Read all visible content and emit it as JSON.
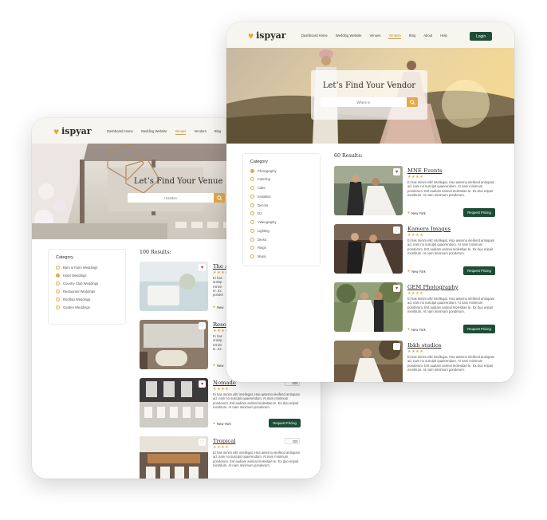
{
  "brand": {
    "name": "ispyar"
  },
  "venue_page": {
    "nav": [
      "Dashboard Home",
      "Wedding Website",
      "Venues",
      "Vendors",
      "Blog"
    ],
    "active_nav": "Venues",
    "hero_title": "Let’s Find Your Venue",
    "search_placeholder": "Houston",
    "filter": {
      "title": "Category",
      "options": [
        "Barn & Farm Weddings",
        "Hotel Weddings",
        "Country Club Weddings",
        "Restaurant Weddings",
        "Rooftop Weddings",
        "Garden Weddings"
      ],
      "selected": "Hotel Weddings"
    },
    "results_title": "100 Results:",
    "cards": [
      {
        "name": "The A",
        "location": "New",
        "liked": true
      },
      {
        "name": "Reso",
        "location": "New",
        "liked": false
      },
      {
        "name": "Nomade",
        "likes": "609",
        "description": "Ei has minim elitr intellegat. Hsa aeterno eleifend antiopam ad, nam no suscipit quaerendum. At nam minimum ponderum. Est audiam animal molestiae te. Ex duo eripuit mentitum. At nam minimum ponderum.",
        "location": "New York",
        "button": "Request Pricing",
        "liked": true
      },
      {
        "name": "Tropical",
        "likes": "309",
        "description": "Ei has minim elitr intellegat. Hsa aeterno eleifend antiopam ad, nam no suscipit quaerendum. At nam minimum ponderum. Est audiam animal molestiae te. Ex duo eripuit mentitum. At nam minimum ponderum.",
        "liked": false
      }
    ],
    "partial_desc": [
      "Ei has",
      "antiop",
      "minim",
      "te. Ex",
      "ponder"
    ]
  },
  "vendor_page": {
    "nav": [
      "Dashboard Home",
      "Wedding Website",
      "Venues",
      "Vendors",
      "Blog",
      "About",
      "Help"
    ],
    "active_nav": "Vendors",
    "login_label": "Login",
    "hero_title": "Let’s Find Your Vendor",
    "search_placeholder": "Where in",
    "filter": {
      "title": "Category",
      "options": [
        "Photography",
        "Catering",
        "Cake",
        "Invitation",
        "Decors",
        "DJ",
        "Videography",
        "Lighting",
        "Dress",
        "Rings",
        "Music"
      ],
      "selected": "Photography"
    },
    "results_title": "60 Results:",
    "cards": [
      {
        "name": "MNE Events",
        "description": "Ei has minim elitr intellegat. Hsa aeterno eleifend antiopam ad, nam no suscipit quaerendum. At nam minimum ponderum. Est audiam animal molestiae te. Ex duo eripuit mentitum. At nam minimum ponderum.",
        "location": "New York",
        "button": "Request Pricing",
        "liked": true
      },
      {
        "name": "Kamera Images",
        "description": "Ei has minim elitr intellegat. Hsa aeterno eleifend antiopam ad, nam no suscipit quaerendum. At nam minimum ponderum. Est audiam animal molestiae te. Ex duo eripuit mentitum. At nam minimum ponderum.",
        "location": "New York",
        "button": "Request Pricing",
        "liked": false
      },
      {
        "name": "GEM Photography",
        "description": "Ei has minim elitr intellegat. Hsa aeterno eleifend antiopam ad, nam no suscipit quaerendum. At nam minimum ponderum. Est audiam animal molestiae te. Ex duo eripuit mentitum. At nam minimum ponderum.",
        "location": "New York",
        "button": "Request Pricing",
        "liked": true
      },
      {
        "name": "Ibkh studios",
        "description": "Ei has minim elitr intellegat. Hsa aeterno eleifend antiopam ad, nam no suscipit quaerendum. At nam minimum ponderum. Est audiam animal molestiae te. Ex duo eripuit mentitum. At nam minimum ponderum.",
        "liked": false
      }
    ]
  },
  "colors": {
    "accent": "#e3a94a",
    "primary_button": "#1d4d36",
    "nav_bg": "#f7f5ef"
  },
  "icons": {
    "heart": "heart-icon",
    "search": "search-icon",
    "pin": "map-pin-icon",
    "star": "star-icon"
  }
}
